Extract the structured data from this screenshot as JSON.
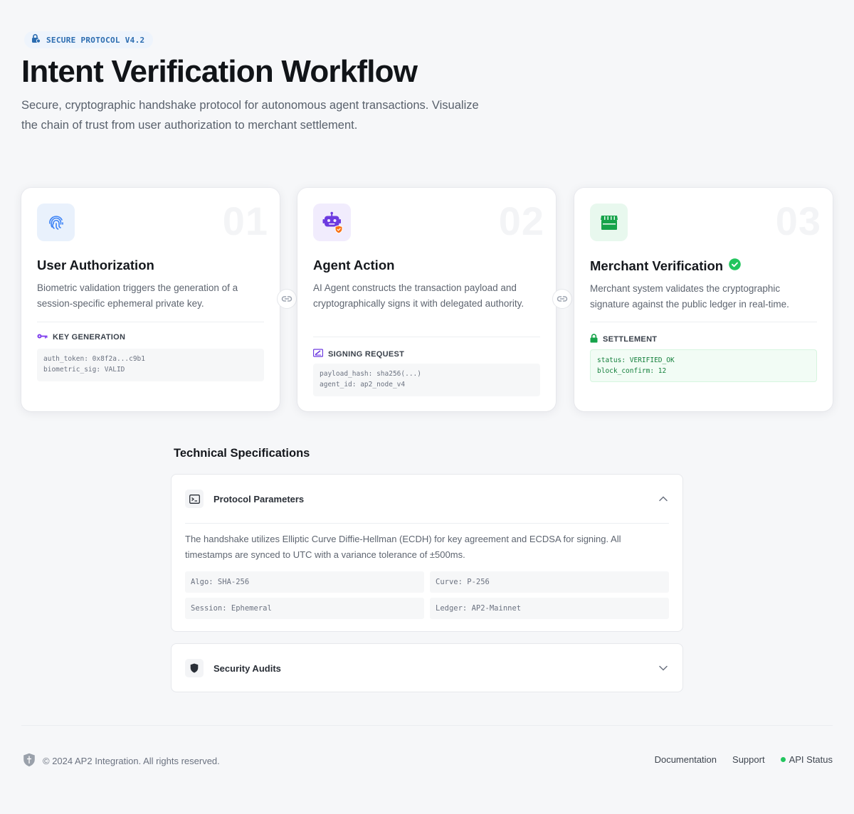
{
  "header": {
    "badge": "SECURE PROTOCOL V4.2",
    "title": "Intent Verification Workflow",
    "subtitle": "Secure, cryptographic handshake protocol for autonomous agent transactions. Visualize the chain of trust from user authorization to merchant settlement."
  },
  "steps": [
    {
      "number": "01",
      "icon": "fingerprint-icon",
      "title": "User Authorization",
      "description": "Biometric validation triggers the generation of a session-specific ephemeral private key.",
      "label": "KEY GENERATION",
      "code": [
        "auth_token: 0x8f2a...c9b1",
        "biometric_sig: VALID"
      ]
    },
    {
      "number": "02",
      "icon": "robot-icon",
      "title": "Agent Action",
      "description": "AI Agent constructs the transaction payload and cryptographically signs it with delegated authority.",
      "label": "SIGNING REQUEST",
      "code": [
        "payload_hash: sha256(...)",
        "agent_id: ap2_node_v4"
      ]
    },
    {
      "number": "03",
      "icon": "storefront-icon",
      "title": "Merchant Verification",
      "description": "Merchant system validates the cryptographic signature against the public ledger in real-time.",
      "label": "SETTLEMENT",
      "code": [
        "status: VERIFIED_OK",
        "block_confirm: 12"
      ]
    }
  ],
  "specs": {
    "title": "Technical Specifications",
    "protocol": {
      "title": "Protocol Parameters",
      "body": "The handshake utilizes Elliptic Curve Diffie-Hellman (ECDH) for key agreement and ECDSA for signing. All timestamps are synced to UTC with a variance tolerance of ±500ms.",
      "params": [
        "Algo: SHA-256",
        "Curve: P-256",
        "Session: Ephemeral",
        "Ledger: AP2-Mainnet"
      ]
    },
    "audits": {
      "title": "Security Audits"
    }
  },
  "footer": {
    "copyright": "© 2024 AP2 Integration. All rights reserved.",
    "links": [
      "Documentation",
      "Support",
      "API Status"
    ]
  },
  "colors": {
    "accent_blue": "#2b6cb0",
    "accent_purple": "#6d3be0",
    "accent_green": "#16a34a",
    "status_green": "#22c55e"
  }
}
